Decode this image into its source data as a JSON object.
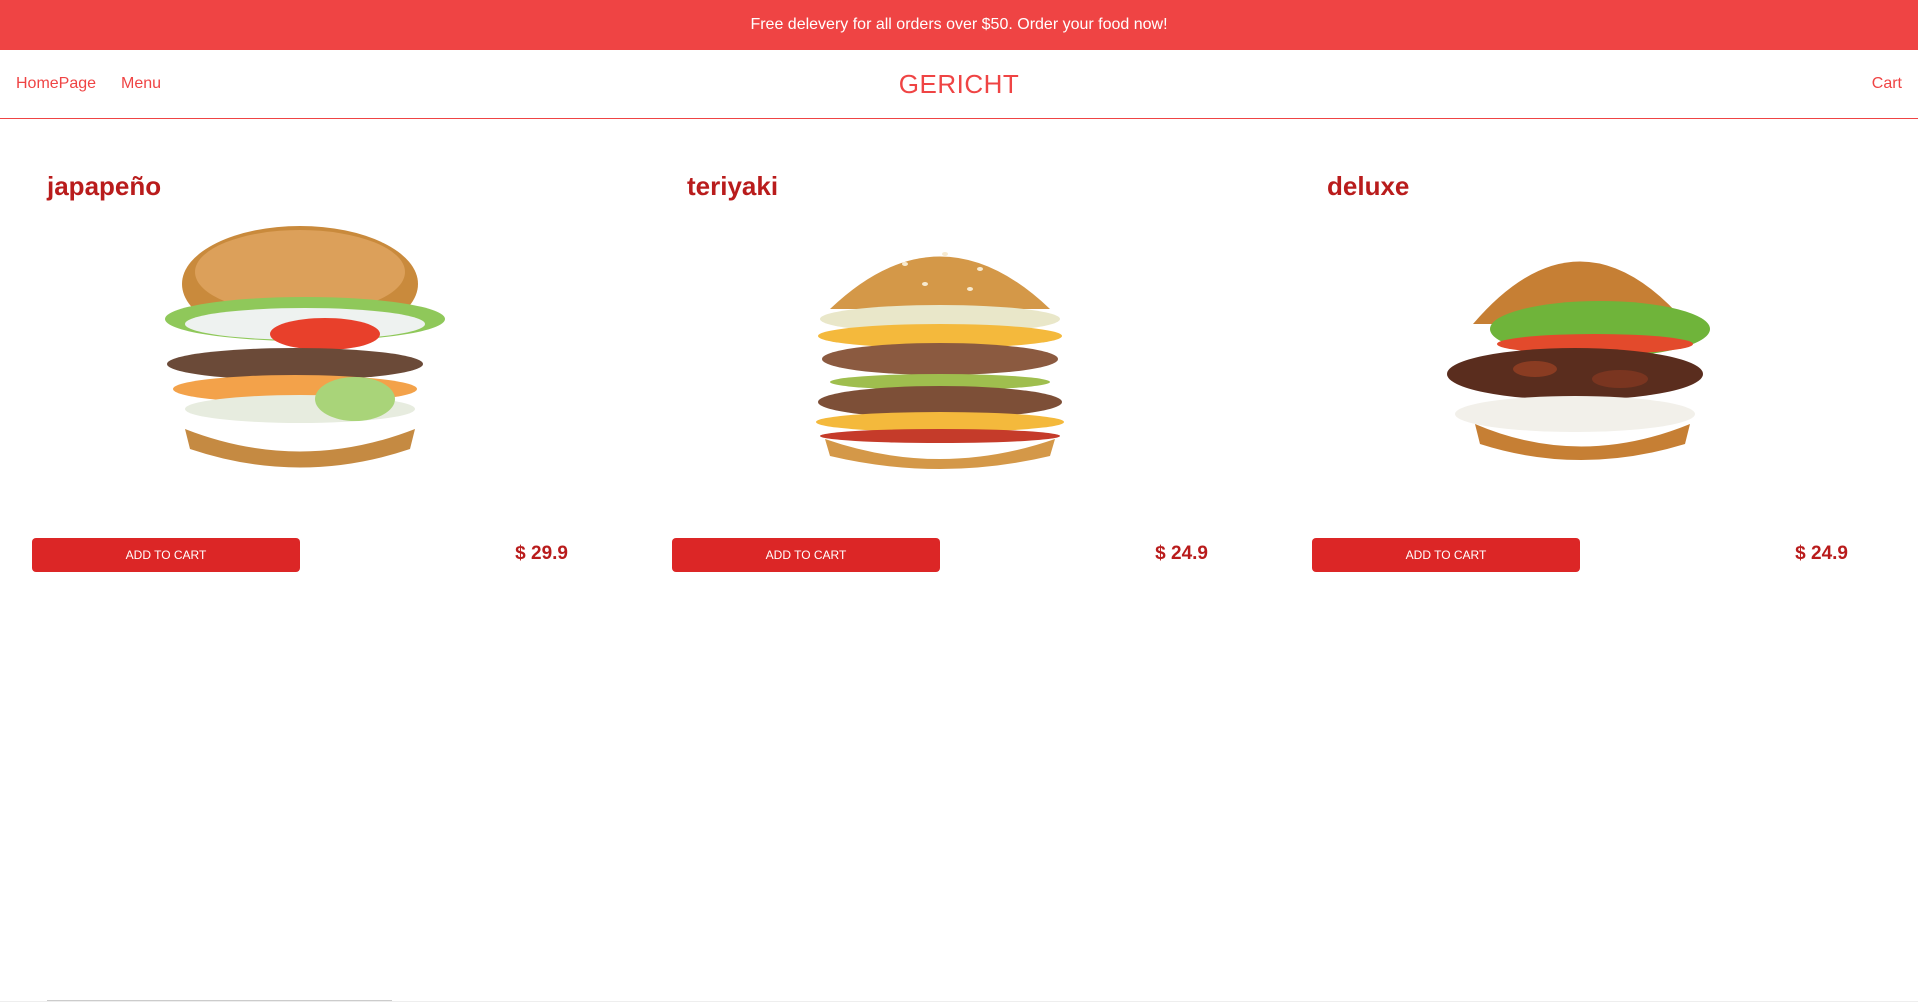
{
  "banner": {
    "text": "Free delevery for all orders over $50. Order your food now!"
  },
  "nav": {
    "links": [
      {
        "label": "HomePage"
      },
      {
        "label": "Menu"
      }
    ],
    "brand": "GERICHT",
    "cart_label": "Cart"
  },
  "colors": {
    "accent": "#ef4444",
    "button": "#dc2626",
    "title": "#b91c1c"
  },
  "products": [
    {
      "name": "japapeño",
      "button_label": "ADD TO CART",
      "price": "$ 29.9",
      "image": "burger-jalapeno-image"
    },
    {
      "name": "teriyaki",
      "button_label": "ADD TO CART",
      "price": "$ 24.9",
      "image": "burger-double-cheese-image"
    },
    {
      "name": "deluxe",
      "button_label": "ADD TO CART",
      "price": "$ 24.9",
      "image": "burger-glazed-patty-image"
    }
  ]
}
